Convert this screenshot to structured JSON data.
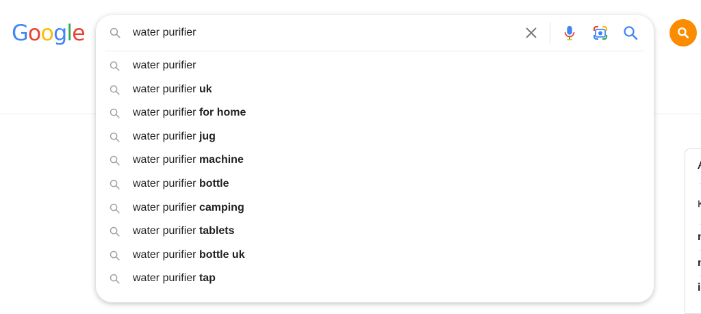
{
  "logo": {
    "letters": [
      {
        "ch": "G",
        "color": "#4285F4"
      },
      {
        "ch": "o",
        "color": "#EA4335"
      },
      {
        "ch": "o",
        "color": "#FBBC05"
      },
      {
        "ch": "g",
        "color": "#4285F4"
      },
      {
        "ch": "l",
        "color": "#34A853"
      },
      {
        "ch": "e",
        "color": "#EA4335"
      }
    ]
  },
  "search": {
    "query": "water purifier",
    "icons": {
      "lead": "search-icon",
      "clear": "close-icon",
      "voice": "microphone-icon",
      "lens": "camera-lens-icon",
      "submit": "search-icon"
    }
  },
  "suggestions": [
    {
      "prefix": "water purifier",
      "suffix": ""
    },
    {
      "prefix": "water purifier",
      "suffix": "uk"
    },
    {
      "prefix": "water purifier",
      "suffix": "for home"
    },
    {
      "prefix": "water purifier",
      "suffix": "jug"
    },
    {
      "prefix": "water purifier",
      "suffix": "machine"
    },
    {
      "prefix": "water purifier",
      "suffix": "bottle"
    },
    {
      "prefix": "water purifier",
      "suffix": "camping"
    },
    {
      "prefix": "water purifier",
      "suffix": "tablets"
    },
    {
      "prefix": "water purifier",
      "suffix": "bottle uk"
    },
    {
      "prefix": "water purifier",
      "suffix": "tap"
    }
  ],
  "side_card": {
    "title_fragment": "A",
    "fragments": [
      "K",
      "n",
      "n",
      "i"
    ]
  },
  "colors": {
    "accent_blue": "#4285F4",
    "avatar_orange": "#FB8C00",
    "icon_grey": "#9aa0a6"
  }
}
